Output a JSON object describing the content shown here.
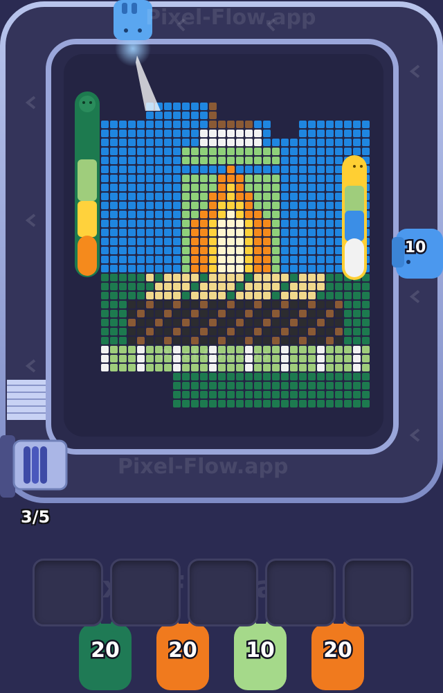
{
  "watermark": {
    "text": "Pixel-flow.app",
    "text_alt": "Pixel-Flow.app"
  },
  "conveyor_shooter": {
    "ammo": "10",
    "color": "#3b8ee6"
  },
  "loader_shooter": {
    "ammo": "",
    "color": "#5aa6f0"
  },
  "level_progress": "3/5",
  "wait_slots": [
    {
      "state": "empty"
    },
    {
      "state": "empty"
    },
    {
      "state": "empty"
    },
    {
      "state": "empty"
    },
    {
      "state": "empty"
    }
  ],
  "queue_shooters": [
    {
      "ammo": "20",
      "color": "#1f7a55"
    },
    {
      "ammo": "20",
      "color": "#f07a1e"
    },
    {
      "ammo": "10",
      "color": "#a5d98a"
    },
    {
      "ammo": "20",
      "color": "#f07a1e"
    }
  ],
  "colors": {
    "sky": "#1f86e0",
    "grass_dark": "#1d7a4f",
    "grass_light": "#9fcd7c",
    "flame_orange": "#f58a1c",
    "flame_yellow": "#ffd23c",
    "flame_white": "#fff6d0",
    "wood": "#8a5a35",
    "charcoal": "#2c2c30",
    "sand": "#f0d88c",
    "snow": "#f2f2f2",
    "tent": "#8fd07a"
  },
  "icons": [
    "blue-shooter-icon",
    "green-stack-icon",
    "yellow-stack-icon",
    "spool-stack-icon"
  ]
}
